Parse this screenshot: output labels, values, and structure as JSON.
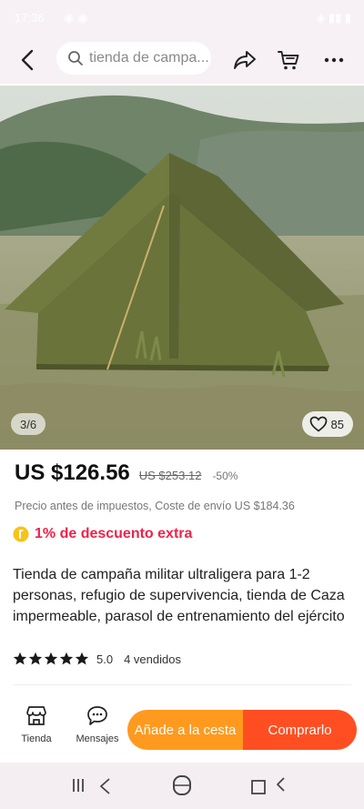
{
  "status_bar": {
    "time": "17:36",
    "dots": "◉ ◉",
    "right_icons": "◈ ▮▮ ▮"
  },
  "search": {
    "placeholder": "tienda de campa..."
  },
  "gallery": {
    "counter": "3/6",
    "likes": "85"
  },
  "price": {
    "current": "US $126.56",
    "original": "US $253.12",
    "discount": "-50%"
  },
  "tax_line": "Precio antes de impuestos, Coste de envío US $184.36",
  "coupon": {
    "text": "1% de descuento extra"
  },
  "product": {
    "title": "Tienda de campaña militar ultraligera para 1-2 personas, refugio de supervivencia, tienda de Caza impermeable, parasol de entrenamiento del ejército",
    "rating": "5.0",
    "stars": 5,
    "sold": "4 vendidos"
  },
  "bottom": {
    "store_label": "Tienda",
    "messages_label": "Mensajes",
    "add_to_cart": "Añade a la cesta",
    "buy_now": "Comprarlo"
  },
  "colors": {
    "accent": "#ff4f22",
    "cart_orange": "#ff9a1f",
    "coupon_red": "#f0224a"
  },
  "icons": [
    "back-icon",
    "search-icon",
    "share-icon",
    "cart-icon",
    "more-icon",
    "heart-icon",
    "star-icon",
    "coin-icon",
    "store-icon",
    "chat-icon"
  ]
}
